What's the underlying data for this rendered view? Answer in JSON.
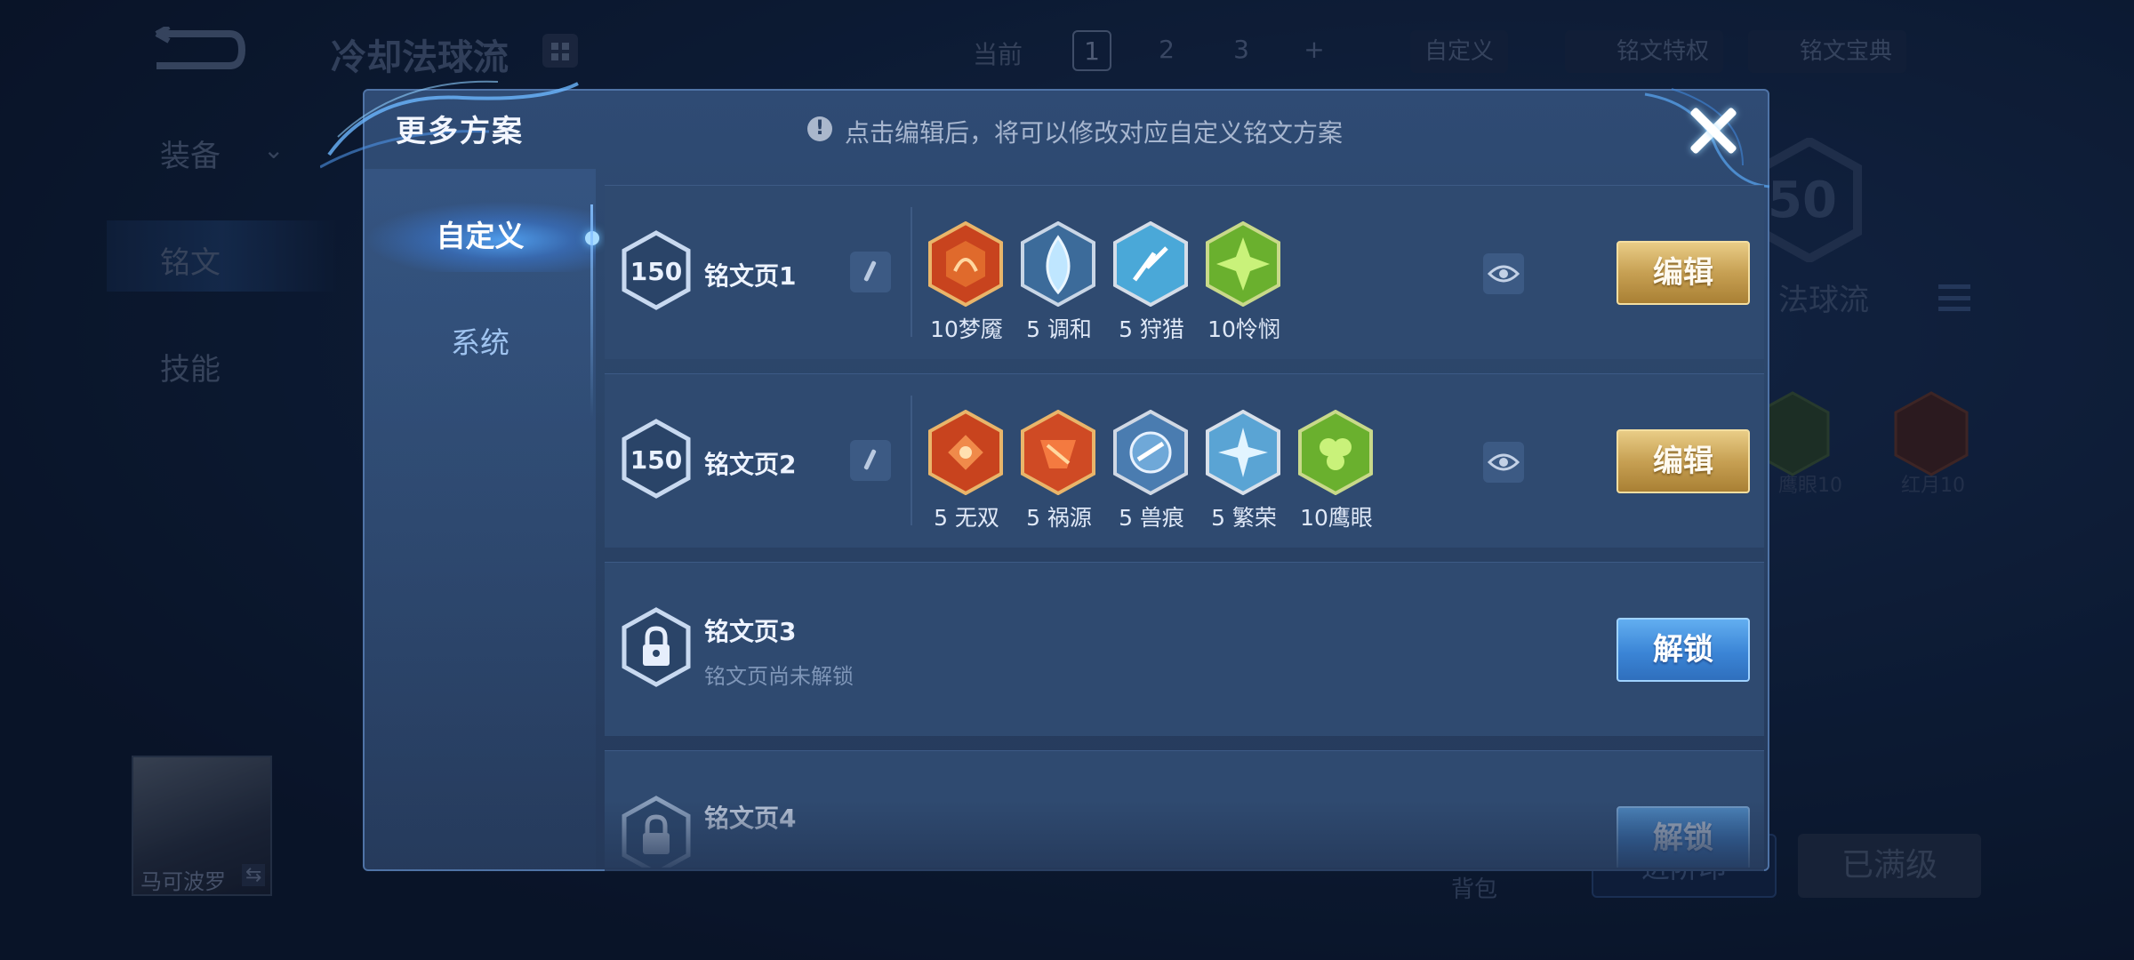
{
  "background": {
    "title": "冷却法球流",
    "current_label": "当前",
    "pages": [
      "1",
      "2",
      "3",
      "+"
    ],
    "custom_label": "自定义",
    "rune_feature_label": "铭文特权",
    "rune_guide_label": "铭文宝典",
    "side_menu": [
      "装备",
      "铭文",
      "技能"
    ],
    "level_number": "50",
    "build_name": "法球流",
    "rune_labels": [
      "鹰眼10",
      "红月10"
    ],
    "hero_name": "马可波罗",
    "bag_label": "背包",
    "upgrade_label": "进阶印",
    "maxed_label": "已满级"
  },
  "modal": {
    "title": "更多方案",
    "hint": "点击编辑后，将可以修改对应自定义铭文方案",
    "hint_icon": "exclamation-icon",
    "close_icon": "close-icon",
    "tabs": [
      {
        "label": "自定义",
        "active": true
      },
      {
        "label": "系统",
        "active": false
      }
    ],
    "pages": [
      {
        "level": "150",
        "name": "铭文页1",
        "action": "编辑",
        "runes": [
          {
            "label": "10梦魇",
            "color": "#c8431e"
          },
          {
            "label": "5 调和",
            "color": "#5a9ad0"
          },
          {
            "label": "5 狩猎",
            "color": "#4aa8d8"
          },
          {
            "label": "10怜悯",
            "color": "#6ab02e"
          }
        ]
      },
      {
        "level": "150",
        "name": "铭文页2",
        "action": "编辑",
        "runes": [
          {
            "label": "5 无双",
            "color": "#c8431e"
          },
          {
            "label": "5 祸源",
            "color": "#cf4a24"
          },
          {
            "label": "5 兽痕",
            "color": "#4a7cb0"
          },
          {
            "label": "5 繁荣",
            "color": "#5aa4d4"
          },
          {
            "label": "10鹰眼",
            "color": "#6ab02e"
          }
        ]
      },
      {
        "name": "铭文页3",
        "status": "铭文页尚未解锁",
        "action": "解锁"
      },
      {
        "name": "铭文页4",
        "action": "解锁"
      }
    ]
  },
  "colors": {
    "edit_button": "#c7a053",
    "unlock_button": "#3b85d6",
    "modal_bg": "#2b4569",
    "accent": "#54aaff"
  }
}
